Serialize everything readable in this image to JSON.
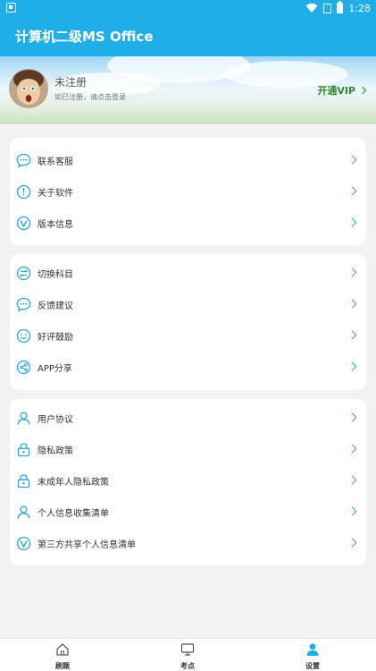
{
  "status_bar": {
    "time": "1:28"
  },
  "app": {
    "title": "计算机二级MS Office"
  },
  "profile": {
    "name": "未注册",
    "hint": "如已注册，请点击登录",
    "vip_label": "开通VIP"
  },
  "groups": [
    {
      "items": [
        {
          "icon": "chat-bubble-icon",
          "label": "联系客服"
        },
        {
          "icon": "info-icon",
          "label": "关于软件"
        },
        {
          "icon": "version-icon",
          "label": "版本信息"
        }
      ]
    },
    {
      "items": [
        {
          "icon": "switch-icon",
          "label": "切换科目"
        },
        {
          "icon": "feedback-icon",
          "label": "反馈建议"
        },
        {
          "icon": "smile-icon",
          "label": "好评鼓励"
        },
        {
          "icon": "share-icon",
          "label": "APP分享"
        }
      ]
    },
    {
      "items": [
        {
          "icon": "user-icon",
          "label": "用户协议"
        },
        {
          "icon": "lock-icon",
          "label": "隐私政策"
        },
        {
          "icon": "lock-icon",
          "label": "未成年人隐私政策"
        },
        {
          "icon": "user-icon",
          "label": "个人信息收集清单"
        },
        {
          "icon": "version-icon",
          "label": "第三方共享个人信息清单"
        }
      ]
    }
  ],
  "nav": [
    {
      "icon": "home-icon",
      "label": "刷题"
    },
    {
      "icon": "monitor-icon",
      "label": "考点"
    },
    {
      "icon": "person-icon",
      "label": "设置",
      "active": true
    }
  ],
  "colors": {
    "primary": "#1faee8",
    "icon": "#2aa4e3",
    "vip": "#2a8a2a"
  }
}
